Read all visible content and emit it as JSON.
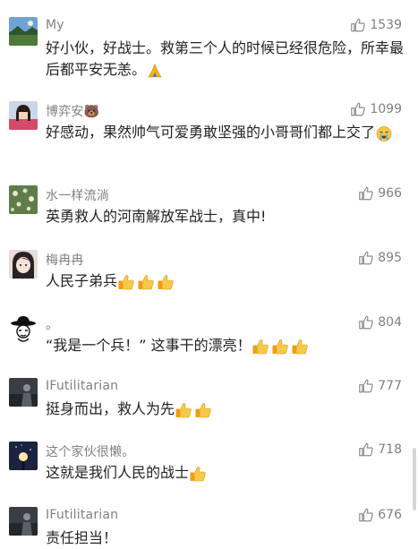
{
  "comments": [
    {
      "name": "My",
      "likes": "1539",
      "text": "好小伙，好战士。救第三个人的时候已经很危险，所幸最后都平安无恙。",
      "avatar_icon": "landscape-avatar",
      "emojis": [
        "pray"
      ]
    },
    {
      "name": "博弈安🐻",
      "likes": "1099",
      "text": "好感动，果然帅气可爱勇敢坚强的小哥哥们都上交了",
      "avatar_icon": "girl-photo-avatar",
      "emojis": [
        "crying-face"
      ]
    },
    {
      "name": "水一样流淌",
      "likes": "966",
      "text": "英勇救人的河南解放军战士，真中!",
      "avatar_icon": "flowers-avatar",
      "emojis": []
    },
    {
      "name": "梅冉冉",
      "likes": "895",
      "text": "人民子弟兵",
      "avatar_icon": "anime-girl-avatar",
      "emojis": [
        "thumbs-up",
        "thumbs-up",
        "thumbs-up"
      ]
    },
    {
      "name": "。",
      "likes": "804",
      "text": "“我是一个兵！”  这事干的漂亮！",
      "avatar_icon": "hat-cartoon-avatar",
      "emojis": [
        "thumbs-up",
        "thumbs-up",
        "thumbs-up"
      ]
    },
    {
      "name": "IFutilitarian",
      "likes": "777",
      "text": "挺身而出，救人为先",
      "avatar_icon": "dark-photo-avatar",
      "emojis": [
        "thumbs-up",
        "thumbs-up"
      ]
    },
    {
      "name": "这个家伙很懒。",
      "likes": "718",
      "text": "这就是我们人民的战士",
      "avatar_icon": "night-sky-avatar",
      "emojis": [
        "thumbs-up"
      ]
    },
    {
      "name": "IFutilitarian",
      "likes": "676",
      "text": "责任担当！",
      "avatar_icon": "dark-photo-avatar",
      "emojis": []
    }
  ],
  "colors": {
    "name": "#808080",
    "text": "#222222",
    "like_icon": "#8a8a8a"
  }
}
